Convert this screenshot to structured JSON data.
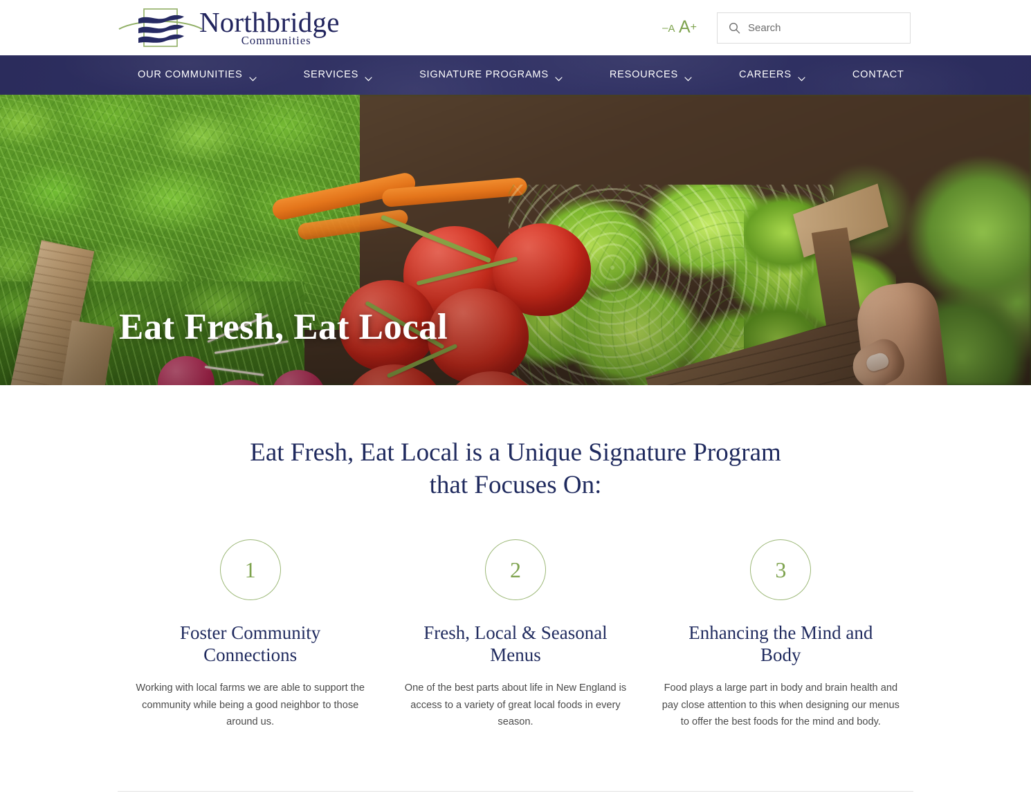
{
  "header": {
    "logo": {
      "name": "Northbridge",
      "subtitle": "Communities",
      "mark_icon": "northbridge-waves-logo-icon"
    },
    "text_size": {
      "minus": "–",
      "small_a": "A",
      "big_a": "A",
      "plus": "+"
    },
    "search": {
      "placeholder": "Search",
      "value": "",
      "icon": "search-icon"
    }
  },
  "nav": {
    "items": [
      {
        "label": "OUR COMMUNITIES",
        "has_caret": true
      },
      {
        "label": "SERVICES",
        "has_caret": true
      },
      {
        "label": "SIGNATURE PROGRAMS",
        "has_caret": true
      },
      {
        "label": "RESOURCES",
        "has_caret": true
      },
      {
        "label": "CAREERS",
        "has_caret": true
      },
      {
        "label": "CONTACT",
        "has_caret": false
      }
    ]
  },
  "hero": {
    "title": "Eat Fresh, Eat Local",
    "image_alt": "Hands holding a wooden crate of fresh tomatoes, lettuce, carrots, radishes and herbs in a garden"
  },
  "main": {
    "heading_line1": "Eat Fresh, Eat Local is a Unique Signature Program",
    "heading_line2": "that Focuses On:",
    "columns": [
      {
        "number": "1",
        "title": "Foster Community Connections",
        "body": "Working with local farms we are able to support the community while being a good neighbor to those around us."
      },
      {
        "number": "2",
        "title": "Fresh, Local & Seasonal Menus",
        "body": "One of the best parts about life in New England is access to a variety of great local foods in every season."
      },
      {
        "number": "3",
        "title": "Enhancing the Mind and Body",
        "body": "Food plays a large part in body and brain health and pay close attention to this when designing our menus to offer the best foods for the mind and body."
      }
    ]
  },
  "colors": {
    "navy": "#2e2f63",
    "heading_navy": "#1f2a5e",
    "accent_green": "#7ea34e",
    "circle_border": "#9cb877",
    "body_text": "#4a4a4a",
    "divider": "#e2e2e2"
  }
}
